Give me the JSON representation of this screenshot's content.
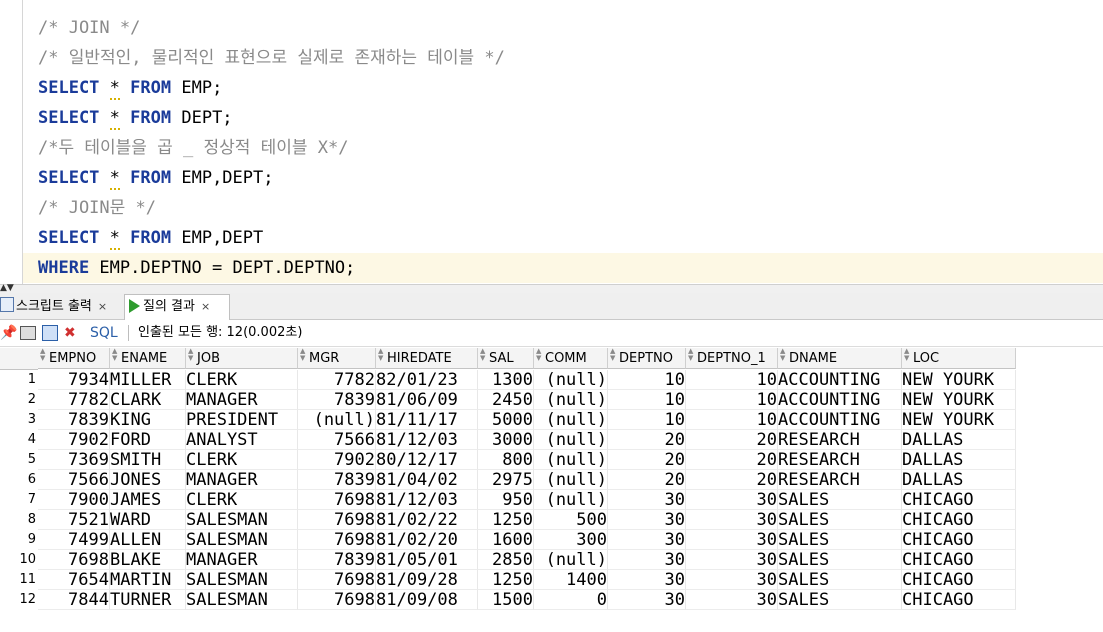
{
  "editor": {
    "lines": [
      [
        {
          "t": "/* JOIN */",
          "c": "cmt"
        }
      ],
      [
        {
          "t": "/* 일반적인, 물리적인 표현으로 실제로 존재하는 테이블 */",
          "c": "cmt"
        }
      ],
      [
        {
          "t": "SELECT",
          "c": "kw"
        },
        {
          "t": " ",
          "c": ""
        },
        {
          "t": "*",
          "c": "star"
        },
        {
          "t": " ",
          "c": ""
        },
        {
          "t": "FROM",
          "c": "kw"
        },
        {
          "t": " EMP;",
          "c": ""
        }
      ],
      [
        {
          "t": "SELECT",
          "c": "kw"
        },
        {
          "t": " ",
          "c": ""
        },
        {
          "t": "*",
          "c": "star"
        },
        {
          "t": " ",
          "c": ""
        },
        {
          "t": "FROM",
          "c": "kw"
        },
        {
          "t": " DEPT;",
          "c": ""
        }
      ],
      [
        {
          "t": "/*두 테이블을 곱 _ 정상적 테이블 X*/",
          "c": "cmt"
        }
      ],
      [
        {
          "t": "SELECT",
          "c": "kw"
        },
        {
          "t": " ",
          "c": ""
        },
        {
          "t": "*",
          "c": "star"
        },
        {
          "t": " ",
          "c": ""
        },
        {
          "t": "FROM",
          "c": "kw"
        },
        {
          "t": " EMP,DEPT;",
          "c": ""
        }
      ],
      [
        {
          "t": "/* JOIN문 */",
          "c": "cmt"
        }
      ],
      [
        {
          "t": "SELECT",
          "c": "kw"
        },
        {
          "t": " ",
          "c": ""
        },
        {
          "t": "*",
          "c": "star"
        },
        {
          "t": " ",
          "c": ""
        },
        {
          "t": "FROM",
          "c": "kw"
        },
        {
          "t": " EMP,DEPT",
          "c": ""
        }
      ],
      [
        {
          "t": "WHERE",
          "c": "kw"
        },
        {
          "t": " EMP.DEPTNO = DEPT.DEPTNO;",
          "c": ""
        }
      ]
    ]
  },
  "tabs": {
    "script_output": "스크립트 출력",
    "query_result": "질의 결과",
    "close_glyph": "×"
  },
  "toolbar": {
    "sql_label": "SQL",
    "status": "인출된 모든 행: 12(0.002초)"
  },
  "grid": {
    "columns": [
      "EMPNO",
      "ENAME",
      "JOB",
      "MGR",
      "HIREDATE",
      "SAL",
      "COMM",
      "DEPTNO",
      "DEPTNO_1",
      "DNAME",
      "LOC"
    ],
    "numeric": [
      true,
      false,
      false,
      true,
      false,
      true,
      true,
      true,
      true,
      false,
      false
    ],
    "rows": [
      [
        "7934",
        "MILLER",
        "CLERK",
        "7782",
        "82/01/23",
        "1300",
        "(null)",
        "10",
        "10",
        "ACCOUNTING",
        "NEW YOURK"
      ],
      [
        "7782",
        "CLARK",
        "MANAGER",
        "7839",
        "81/06/09",
        "2450",
        "(null)",
        "10",
        "10",
        "ACCOUNTING",
        "NEW YOURK"
      ],
      [
        "7839",
        "KING",
        "PRESIDENT",
        "(null)",
        "81/11/17",
        "5000",
        "(null)",
        "10",
        "10",
        "ACCOUNTING",
        "NEW YOURK"
      ],
      [
        "7902",
        "FORD",
        "ANALYST",
        "7566",
        "81/12/03",
        "3000",
        "(null)",
        "20",
        "20",
        "RESEARCH",
        "DALLAS"
      ],
      [
        "7369",
        "SMITH",
        "CLERK",
        "7902",
        "80/12/17",
        "800",
        "(null)",
        "20",
        "20",
        "RESEARCH",
        "DALLAS"
      ],
      [
        "7566",
        "JONES",
        "MANAGER",
        "7839",
        "81/04/02",
        "2975",
        "(null)",
        "20",
        "20",
        "RESEARCH",
        "DALLAS"
      ],
      [
        "7900",
        "JAMES",
        "CLERK",
        "7698",
        "81/12/03",
        "950",
        "(null)",
        "30",
        "30",
        "SALES",
        "CHICAGO"
      ],
      [
        "7521",
        "WARD",
        "SALESMAN",
        "7698",
        "81/02/22",
        "1250",
        "500",
        "30",
        "30",
        "SALES",
        "CHICAGO"
      ],
      [
        "7499",
        "ALLEN",
        "SALESMAN",
        "7698",
        "81/02/20",
        "1600",
        "300",
        "30",
        "30",
        "SALES",
        "CHICAGO"
      ],
      [
        "7698",
        "BLAKE",
        "MANAGER",
        "7839",
        "81/05/01",
        "2850",
        "(null)",
        "30",
        "30",
        "SALES",
        "CHICAGO"
      ],
      [
        "7654",
        "MARTIN",
        "SALESMAN",
        "7698",
        "81/09/28",
        "1250",
        "1400",
        "30",
        "30",
        "SALES",
        "CHICAGO"
      ],
      [
        "7844",
        "TURNER",
        "SALESMAN",
        "7698",
        "81/09/08",
        "1500",
        "0",
        "30",
        "30",
        "SALES",
        "CHICAGO"
      ]
    ]
  },
  "colors": {
    "keyword": "#1a3b9a",
    "comment": "#8a8a8a",
    "current_line": "#fdf8e4",
    "run_icon": "#2e9b2e"
  }
}
